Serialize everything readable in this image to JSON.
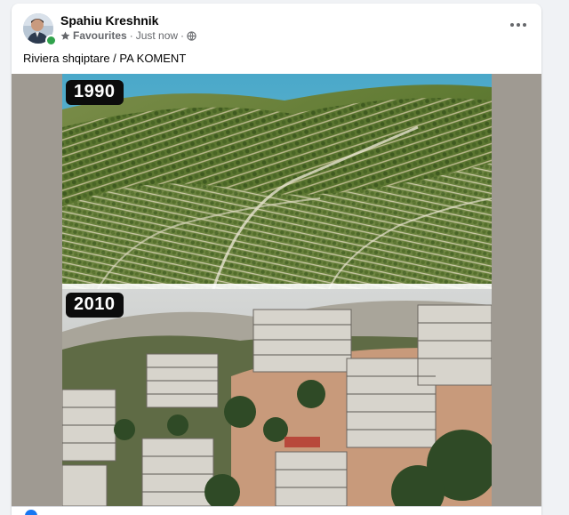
{
  "post": {
    "author": "Spahiu Kreshnik",
    "audience_label": "Favourites",
    "separator": "·",
    "time": "Just now",
    "audience_icon": "star-icon",
    "privacy_icon": "globe-icon",
    "more_icon": "more-options-icon",
    "text": "Riviera shqiptare / PA KOMENT"
  },
  "photo": {
    "top_label": "1990",
    "bottom_label": "2010"
  },
  "colors": {
    "background": "#f0f2f5",
    "card": "#ffffff",
    "online": "#31a24c",
    "meta_text": "#65676b",
    "photo_frame": "#9f9a92"
  }
}
